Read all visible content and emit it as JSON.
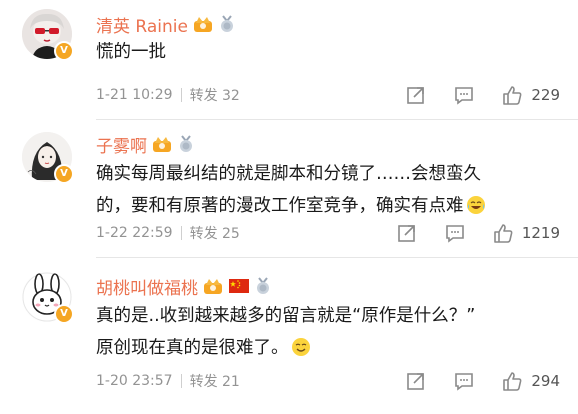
{
  "comments": [
    {
      "username": "清英 Rainie",
      "text": "慌的一批",
      "time": "1-21 10:29",
      "repost": "转发 32",
      "likes": "229",
      "badges": [
        "crown-badge",
        "medal-badge"
      ]
    },
    {
      "username": "子雾啊",
      "text_line1": "确实每周最纠结的就是脚本和分镜了……会想蛮久",
      "text_line2": "的，要和有原著的漫改工作室竞争，确实有点难",
      "time": "1-22 22:59",
      "repost": "转发 25",
      "likes": "1219",
      "badges": [
        "crown-badge",
        "medal-badge"
      ],
      "emoji": "laugh-cry-emoji"
    },
    {
      "username": "胡桃叫做福桃",
      "text_line1": "真的是..收到越来越多的留言就是“原作是什么？”",
      "text_line2": "原创现在真的是很难了。",
      "time": "1-20 23:57",
      "repost": "转发 21",
      "likes": "294",
      "badges": [
        "crown-badge",
        "china-flag-badge",
        "medal-badge"
      ],
      "emoji": "smile-emoji"
    }
  ],
  "verified_mark": "V",
  "colors": {
    "username": "#eb7350",
    "meta": "#939393",
    "verified": "#f5a623",
    "icon": "#8a8a8a"
  }
}
